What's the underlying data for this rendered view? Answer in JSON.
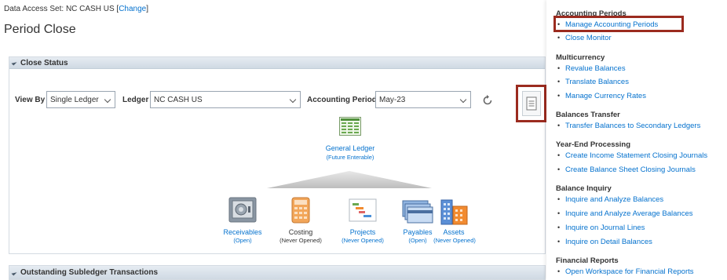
{
  "header": {
    "data_access_label": "Data Access Set:",
    "data_access_value": "NC CASH US",
    "change_link": "Change",
    "page_title": "Period Close"
  },
  "close_status": {
    "title": "Close Status",
    "view_by_label": "View By",
    "view_by_value": "Single Ledger",
    "ledger_label": "Ledger",
    "ledger_value": "NC CASH US",
    "period_label": "Accounting Period",
    "period_value": "May-23",
    "general_ledger": {
      "label": "General Ledger",
      "status": "(Future Enterable)"
    },
    "subledgers": [
      {
        "label": "Receivables",
        "status": "(Open)"
      },
      {
        "label": "Costing",
        "status": "(Never Opened)"
      },
      {
        "label": "Projects",
        "status": "(Never Opened)"
      },
      {
        "label": "Payables",
        "status": "(Open)"
      },
      {
        "label": "Assets",
        "status": "(Never Opened)"
      }
    ]
  },
  "outstanding": {
    "title": "Outstanding Subledger Transactions"
  },
  "task_pane": {
    "sections": [
      {
        "title": "Accounting Periods",
        "links": [
          "Manage Accounting Periods",
          "Close Monitor"
        ]
      },
      {
        "title": "Multicurrency",
        "links": [
          "Revalue Balances",
          "Translate Balances",
          "Manage Currency Rates"
        ]
      },
      {
        "title": "Balances Transfer",
        "links": [
          "Transfer Balances to Secondary Ledgers"
        ]
      },
      {
        "title": "Year-End Processing",
        "links": [
          "Create Income Statement Closing Journals",
          "Create Balance Sheet Closing Journals"
        ]
      },
      {
        "title": "Balance Inquiry",
        "links": [
          "Inquire and Analyze Balances",
          "Inquire and Analyze Average Balances",
          "Inquire on Journal Lines",
          "Inquire on Detail Balances"
        ]
      },
      {
        "title": "Financial Reports",
        "links": [
          "Open Workspace for Financial Reports"
        ]
      }
    ]
  },
  "colors": {
    "link": "#0572ce",
    "highlight": "#9b2b1f",
    "header_bg": "#dbe3eb"
  }
}
